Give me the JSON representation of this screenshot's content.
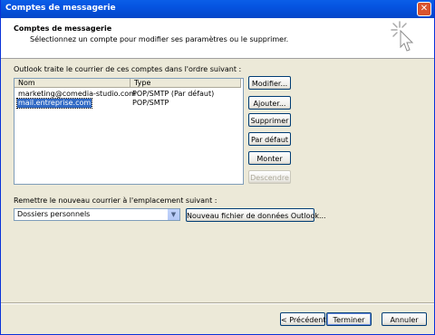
{
  "window": {
    "title": "Comptes de messagerie"
  },
  "header": {
    "title": "Comptes de messagerie",
    "subtitle": "Sélectionnez un compte pour modifier ses paramètres ou le supprimer."
  },
  "accounts": {
    "label": "Outlook traite le courrier de ces comptes dans l'ordre suivant :",
    "columns": [
      "Nom",
      "Type"
    ],
    "rows": [
      {
        "name": "marketing@comedia-studio.com",
        "type": "POP/SMTP (Par défaut)"
      },
      {
        "name": "mail.entreprise.com",
        "type": "POP/SMTP"
      }
    ],
    "selected_index": 1
  },
  "side_buttons": {
    "modify": "Modifier...",
    "add": "Ajouter...",
    "delete": "Supprimer",
    "default": "Par défaut",
    "up": "Monter",
    "down": "Descendre"
  },
  "delivery": {
    "label": "Remettre le nouveau courrier à l'emplacement suivant :",
    "selected": "Dossiers personnels",
    "new_file_button": "Nouveau fichier de données Outlook..."
  },
  "footer": {
    "back": "< Précédent",
    "finish": "Terminer",
    "cancel": "Annuler"
  }
}
